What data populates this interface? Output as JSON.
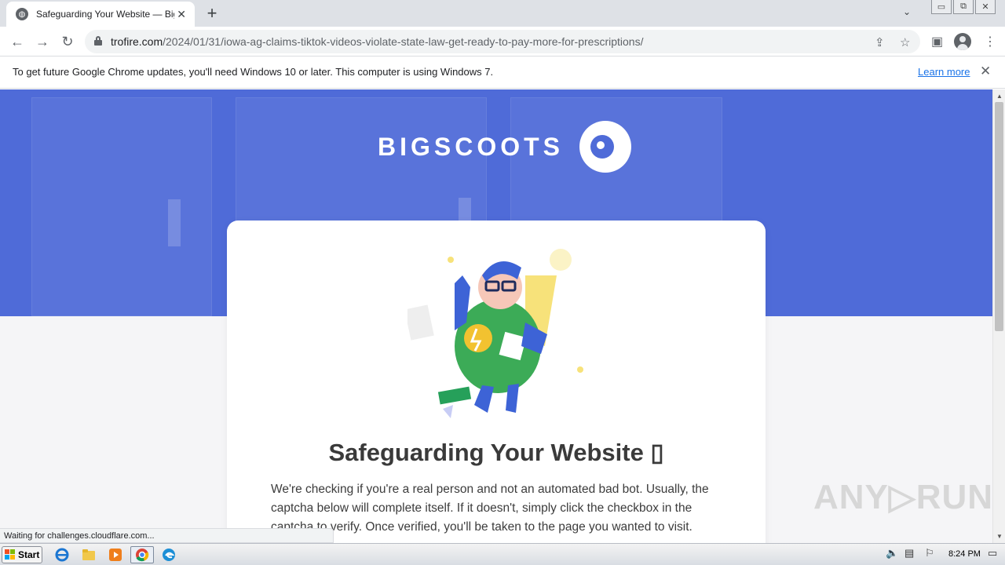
{
  "browser": {
    "tab": {
      "title": "Safeguarding Your Website — BigSc"
    },
    "window_buttons": {
      "minimize": "▭",
      "restore": "⧉",
      "close": "✕"
    },
    "address": {
      "domain": "trofire.com",
      "path": "/2024/01/31/iowa-ag-claims-tiktok-videos-violate-state-law-get-ready-to-pay-more-for-prescriptions/"
    },
    "infobar": {
      "message": "To get future Google Chrome updates, you'll need Windows 10 or later. This computer is using Windows 7.",
      "link": "Learn more"
    },
    "status": "Waiting for challenges.cloudflare.com..."
  },
  "page": {
    "logo_text": "BIGSCOOTS",
    "title": "Safeguarding Your Website ▯",
    "paragraph": "We're checking if you're a real person and not an automated bad bot. Usually, the captcha below will complete itself. If it doesn't, simply click the checkbox in the captcha to verify. Once verified, you'll be taken to the page you wanted to visit."
  },
  "watermark": "ANY▷RUN",
  "taskbar": {
    "start": "Start",
    "clock": "8:24 PM"
  },
  "icons": [
    "globe-icon",
    "close-icon",
    "plus-icon",
    "chevron-down-icon",
    "back-icon",
    "forward-icon",
    "reload-icon",
    "lock-icon",
    "share-icon",
    "star-icon",
    "sidepanel-icon",
    "profile-icon",
    "menu-icon",
    "windows-logo-icon",
    "ie-icon",
    "explorer-icon",
    "media-player-icon",
    "chrome-icon",
    "edge-icon",
    "volume-icon",
    "network-icon",
    "flag-icon",
    "monitor-icon"
  ],
  "colors": {
    "hero": "#4f6bd8",
    "accent_link": "#1a73e8"
  }
}
